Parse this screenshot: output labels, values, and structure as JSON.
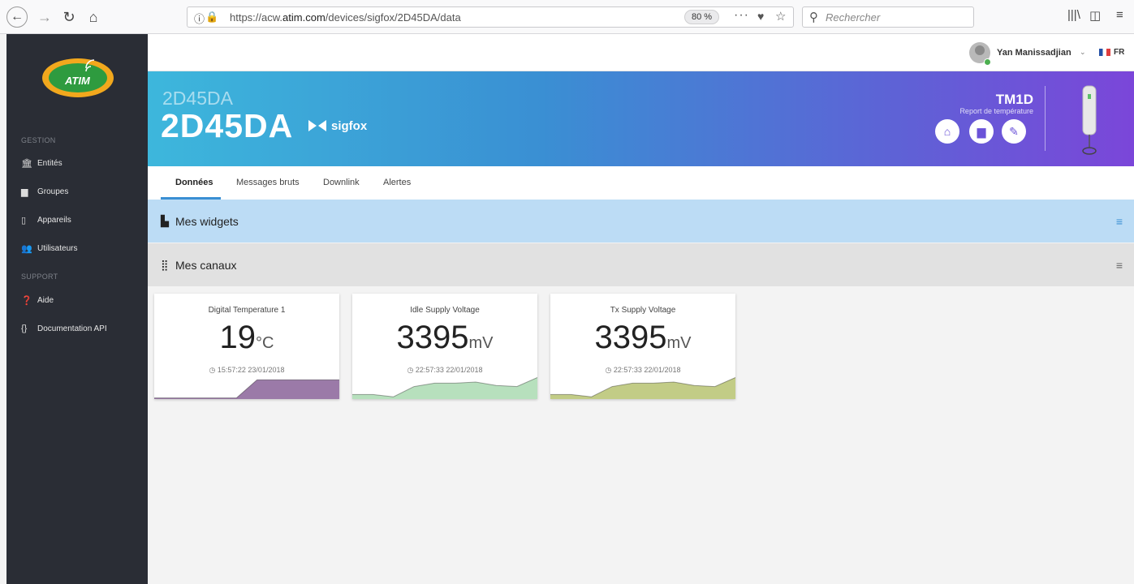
{
  "browser": {
    "url_prefix": "https://acw.",
    "url_domain": "atim.com",
    "url_path": "/devices/sigfox/2D45DA/data",
    "zoom": "80 %",
    "search_placeholder": "Rechercher"
  },
  "sidebar": {
    "logo_text": "ATIM",
    "sections": [
      {
        "title": "GESTION",
        "items": [
          {
            "label": "Entités",
            "icon": "bank-icon"
          },
          {
            "label": "Groupes",
            "icon": "folder-icon"
          },
          {
            "label": "Appareils",
            "icon": "device-icon"
          },
          {
            "label": "Utilisateurs",
            "icon": "users-icon"
          }
        ]
      },
      {
        "title": "SUPPORT",
        "items": [
          {
            "label": "Aide",
            "icon": "help-icon"
          },
          {
            "label": "Documentation API",
            "icon": "braces-icon"
          }
        ]
      }
    ]
  },
  "userbar": {
    "username": "Yan Manissadjian",
    "language": "FR"
  },
  "hero": {
    "subtitle": "2D45DA",
    "title": "2D45DA",
    "network": "sigfox",
    "model": "TM1D",
    "model_description": "Report de température"
  },
  "tabs": [
    {
      "label": "Données",
      "active": true
    },
    {
      "label": "Messages bruts",
      "active": false
    },
    {
      "label": "Downlink",
      "active": false
    },
    {
      "label": "Alertes",
      "active": false
    }
  ],
  "sections": {
    "widgets": {
      "title": "Mes widgets"
    },
    "canaux": {
      "title": "Mes canaux"
    }
  },
  "cards": [
    {
      "title": "Digital Temperature 1",
      "value": "19",
      "unit": "°C",
      "time": "15:57:22 23/01/2018",
      "color": "#9b7aa8",
      "spark": [
        0.05,
        0.05,
        0.05,
        0.05,
        0.05,
        0.85,
        0.85,
        0.85,
        0.85,
        0.85
      ]
    },
    {
      "title": "Idle Supply Voltage",
      "value": "3395",
      "unit": "mV",
      "time": "22:57:33 22/01/2018",
      "color": "#b7e0bd",
      "spark": [
        0.2,
        0.2,
        0.1,
        0.55,
        0.7,
        0.7,
        0.75,
        0.6,
        0.55,
        0.95
      ]
    },
    {
      "title": "Tx Supply Voltage",
      "value": "3395",
      "unit": "mV",
      "time": "22:57:33 22/01/2018",
      "color": "#c2cc86",
      "spark": [
        0.2,
        0.2,
        0.1,
        0.55,
        0.7,
        0.7,
        0.75,
        0.6,
        0.55,
        0.95
      ]
    }
  ]
}
